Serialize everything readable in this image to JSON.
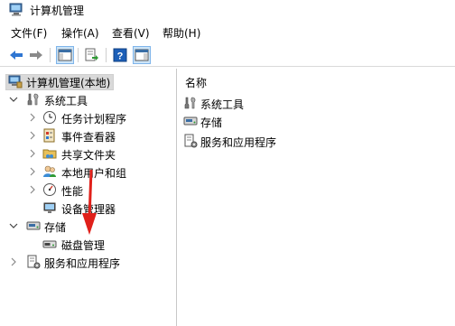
{
  "window": {
    "title": "计算机管理"
  },
  "menu": [
    "文件(F)",
    "操作(A)",
    "查看(V)",
    "帮助(H)"
  ],
  "toolbar": {
    "buttons": [
      "back-icon",
      "forward-icon",
      "show-hide-console-tree-icon",
      "export-list-icon",
      "help-icon",
      "action-pane-icon"
    ]
  },
  "tree": {
    "root": "计算机管理(本地)",
    "system_tools": "系统工具",
    "task_scheduler": "任务计划程序",
    "event_viewer": "事件查看器",
    "shared_folders": "共享文件夹",
    "local_users": "本地用户和组",
    "performance": "性能",
    "device_manager": "设备管理器",
    "storage": "存储",
    "disk_management": "磁盘管理",
    "services_apps": "服务和应用程序"
  },
  "right_pane": {
    "column_header": "名称",
    "items": [
      "系统工具",
      "存储",
      "服务和应用程序"
    ]
  },
  "colors": {
    "selection": "#d9d9d9",
    "annotation_arrow": "#e0201a",
    "accent": "#2f76d2"
  }
}
